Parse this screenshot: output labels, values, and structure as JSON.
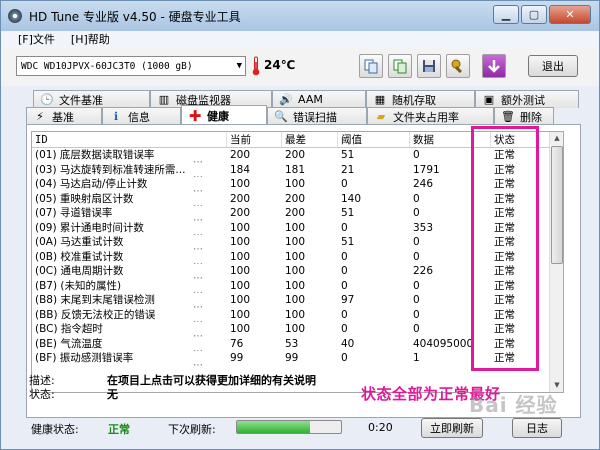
{
  "window": {
    "title": "HD Tune 专业版 v4.50 - 硬盘专业工具"
  },
  "menu": {
    "file": "[F]文件",
    "help": "[H]帮助"
  },
  "toolbar": {
    "drive": "WDC WD10JPVX-60JC3T0     (1000 gB)",
    "temperature": "24℃",
    "exit_label": "退出"
  },
  "tabs_top": [
    "文件基准",
    "磁盘监视器",
    "AAM",
    "随机存取",
    "额外测试"
  ],
  "tabs_bottom": [
    "基准",
    "信息",
    "健康",
    "错误扫描",
    "文件夹占用率",
    "删除"
  ],
  "table": {
    "headers": [
      "ID",
      "当前",
      "最差",
      "阈值",
      "数据",
      "状态"
    ],
    "rows": [
      {
        "id": "(01) 底层数据读取错误率",
        "cur": "200",
        "worst": "200",
        "thr": "51",
        "data": "0",
        "status": "正常"
      },
      {
        "id": "(03) 马达旋转到标准转速所需...",
        "cur": "184",
        "worst": "181",
        "thr": "21",
        "data": "1791",
        "status": "正常"
      },
      {
        "id": "(04) 马达启动/停止计数",
        "cur": "100",
        "worst": "100",
        "thr": "0",
        "data": "246",
        "status": "正常"
      },
      {
        "id": "(05) 重映射扇区计数",
        "cur": "200",
        "worst": "200",
        "thr": "140",
        "data": "0",
        "status": "正常"
      },
      {
        "id": "(07) 寻道错误率",
        "cur": "200",
        "worst": "200",
        "thr": "51",
        "data": "0",
        "status": "正常"
      },
      {
        "id": "(09) 累计通电时间计数",
        "cur": "100",
        "worst": "100",
        "thr": "0",
        "data": "353",
        "status": "正常"
      },
      {
        "id": "(0A) 马达重试计数",
        "cur": "100",
        "worst": "100",
        "thr": "51",
        "data": "0",
        "status": "正常"
      },
      {
        "id": "(0B) 校准重试计数",
        "cur": "100",
        "worst": "100",
        "thr": "0",
        "data": "0",
        "status": "正常"
      },
      {
        "id": "(0C) 通电周期计数",
        "cur": "100",
        "worst": "100",
        "thr": "0",
        "data": "226",
        "status": "正常"
      },
      {
        "id": "(B7) (未知的属性)",
        "cur": "100",
        "worst": "100",
        "thr": "0",
        "data": "0",
        "status": "正常"
      },
      {
        "id": "(B8) 末尾到末尾错误检测",
        "cur": "100",
        "worst": "100",
        "thr": "97",
        "data": "0",
        "status": "正常"
      },
      {
        "id": "(BB) 反馈无法校正的错误",
        "cur": "100",
        "worst": "100",
        "thr": "0",
        "data": "0",
        "status": "正常"
      },
      {
        "id": "(BC) 指令超时",
        "cur": "100",
        "worst": "100",
        "thr": "0",
        "data": "0",
        "status": "正常"
      },
      {
        "id": "(BE) 气流温度",
        "cur": "76",
        "worst": "53",
        "thr": "40",
        "data": "404095000",
        "status": "正常"
      },
      {
        "id": "(BF) 振动感测错误率",
        "cur": "99",
        "worst": "99",
        "thr": "0",
        "data": "1",
        "status": "正常"
      }
    ]
  },
  "description": {
    "desc_label": "描述:",
    "desc_value": "在项目上点击可以获得更加详细的有关说明",
    "status_label": "状态:",
    "status_value": "无"
  },
  "annotation": "状态全部为正常最好",
  "statusbar": {
    "health_label": "健康状态:",
    "health_value": "正常",
    "next_refresh_label": "下次刷新:",
    "timer": "0:20",
    "refresh_btn": "立即刷新",
    "log_btn": "日志",
    "progress": 0.7
  },
  "watermark": "Bai 经验",
  "colors": {
    "highlight": "#e0199a",
    "ok_green": "#1a8a1a"
  }
}
